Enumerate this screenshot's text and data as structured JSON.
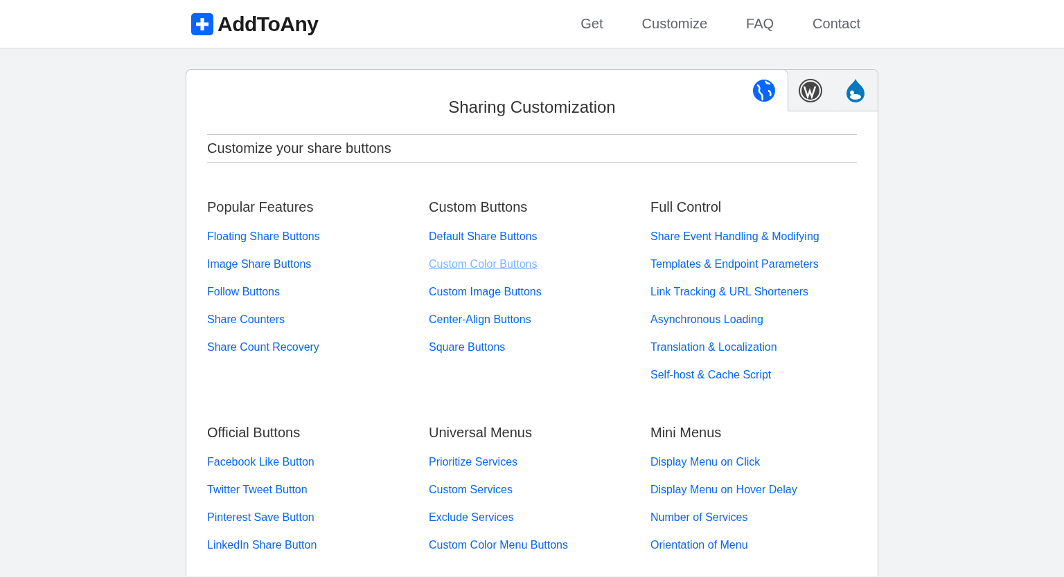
{
  "header": {
    "logo": "AddToAny",
    "nav": [
      "Get",
      "Customize",
      "FAQ",
      "Contact"
    ]
  },
  "platform_tabs": [
    {
      "kind": "globe",
      "selected": true
    },
    {
      "kind": "wordpress",
      "selected": false
    },
    {
      "kind": "drupal",
      "selected": false
    }
  ],
  "title": "Sharing Customization",
  "subtitle": "Customize your share buttons",
  "sections": [
    {
      "heading": "Popular Features",
      "links": [
        {
          "label": "Floating Share Buttons",
          "hovered": false
        },
        {
          "label": "Image Share Buttons",
          "hovered": false
        },
        {
          "label": "Follow Buttons",
          "hovered": false
        },
        {
          "label": "Share Counters",
          "hovered": false
        },
        {
          "label": "Share Count Recovery",
          "hovered": false
        }
      ]
    },
    {
      "heading": "Custom Buttons",
      "links": [
        {
          "label": "Default Share Buttons",
          "hovered": false
        },
        {
          "label": "Custom Color Buttons",
          "hovered": true
        },
        {
          "label": "Custom Image Buttons",
          "hovered": false
        },
        {
          "label": "Center-Align Buttons",
          "hovered": false
        },
        {
          "label": "Square Buttons",
          "hovered": false
        }
      ]
    },
    {
      "heading": "Full Control",
      "links": [
        {
          "label": "Share Event Handling & Modifying",
          "hovered": false
        },
        {
          "label": "Templates & Endpoint Parameters",
          "hovered": false
        },
        {
          "label": "Link Tracking & URL Shorteners",
          "hovered": false
        },
        {
          "label": "Asynchronous Loading",
          "hovered": false
        },
        {
          "label": "Translation & Localization",
          "hovered": false
        },
        {
          "label": "Self-host & Cache Script",
          "hovered": false
        }
      ]
    },
    {
      "heading": "Official Buttons",
      "links": [
        {
          "label": "Facebook Like Button",
          "hovered": false
        },
        {
          "label": "Twitter Tweet Button",
          "hovered": false
        },
        {
          "label": "Pinterest Save Button",
          "hovered": false
        },
        {
          "label": "LinkedIn Share Button",
          "hovered": false
        }
      ]
    },
    {
      "heading": "Universal Menus",
      "links": [
        {
          "label": "Prioritize Services",
          "hovered": false
        },
        {
          "label": "Custom Services",
          "hovered": false
        },
        {
          "label": "Exclude Services",
          "hovered": false
        },
        {
          "label": "Custom Color Menu Buttons",
          "hovered": false
        }
      ]
    },
    {
      "heading": "Mini Menus",
      "links": [
        {
          "label": "Display Menu on Click",
          "hovered": false
        },
        {
          "label": "Display Menu on Hover Delay",
          "hovered": false
        },
        {
          "label": "Number of Services",
          "hovered": false
        },
        {
          "label": "Orientation of Menu",
          "hovered": false
        }
      ]
    }
  ]
}
